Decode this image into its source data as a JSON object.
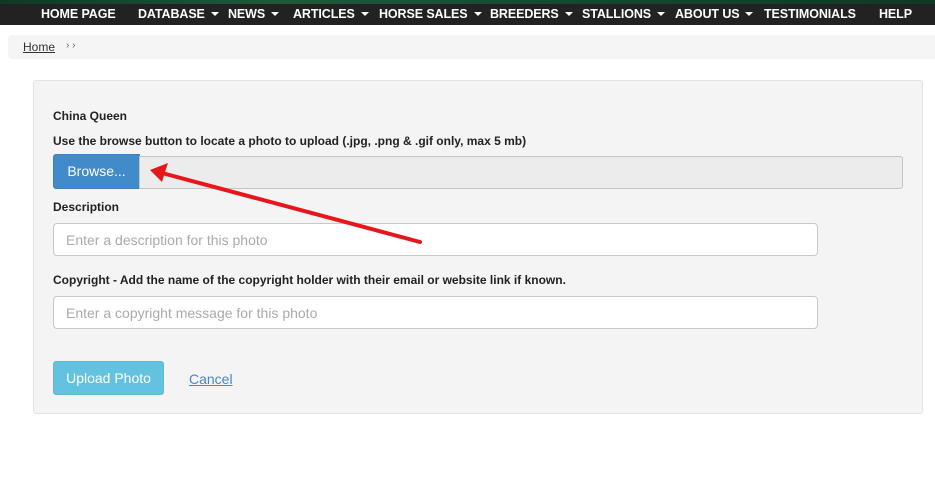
{
  "nav": {
    "items": [
      {
        "label": "HOME PAGE",
        "has_dropdown": false
      },
      {
        "label": "DATABASE",
        "has_dropdown": true
      },
      {
        "label": "NEWS",
        "has_dropdown": true
      },
      {
        "label": "ARTICLES",
        "has_dropdown": true
      },
      {
        "label": "HORSE SALES",
        "has_dropdown": true
      },
      {
        "label": "BREEDERS",
        "has_dropdown": true
      },
      {
        "label": "STALLIONS",
        "has_dropdown": true
      },
      {
        "label": "ABOUT US",
        "has_dropdown": true
      },
      {
        "label": "TESTIMONIALS",
        "has_dropdown": false
      },
      {
        "label": "HELP",
        "has_dropdown": false
      }
    ]
  },
  "breadcrumb": {
    "home": "Home",
    "separator": "› ›"
  },
  "form": {
    "horse_name": "China Queen",
    "upload_instructions": "Use the browse button to locate a photo to upload (.jpg, .png & .gif only, max 5 mb)",
    "browse_label": "Browse...",
    "file_value": "",
    "description_label": "Description",
    "description_placeholder": "Enter a description for this photo",
    "copyright_label": "Copyright - Add the name of the copyright holder with their email or website link if known.",
    "copyright_placeholder": "Enter a copyright message for this photo",
    "upload_button": "Upload Photo",
    "cancel_link": "Cancel"
  },
  "annotation": {
    "type": "arrow",
    "color": "#e8161b",
    "points_to": "browse-button"
  },
  "colors": {
    "navbar_bg": "#222222",
    "primary": "#428bca",
    "info": "#5bc0de",
    "link": "#4a86c5"
  }
}
